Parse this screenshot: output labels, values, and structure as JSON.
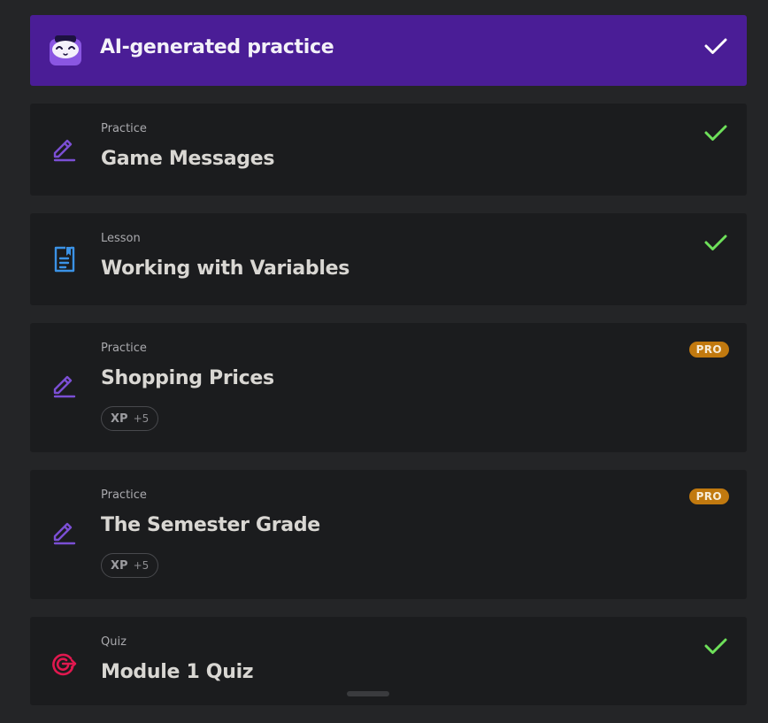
{
  "colors": {
    "background": "#242527",
    "card": "#1b1c1e",
    "ai_banner": "#4a1d96",
    "check_green": "#6ee05a",
    "pencil_purple": "#7b4fd4",
    "lesson_blue": "#3b92e6",
    "quiz_red": "#e0184f",
    "pro_badge": "#c1790f"
  },
  "ai_banner": {
    "title": "AI-generated practice",
    "icon": "ai-mascot-icon",
    "completed": true
  },
  "items": [
    {
      "type": "Practice",
      "title": "Game Messages",
      "icon": "pencil-icon",
      "completed": true
    },
    {
      "type": "Lesson",
      "title": "Working with Variables",
      "icon": "document-icon",
      "completed": true
    },
    {
      "type": "Practice",
      "title": "Shopping Prices",
      "icon": "pencil-icon",
      "badge": "PRO",
      "xp_label": "XP",
      "xp_value": "+5"
    },
    {
      "type": "Practice",
      "title": "The Semester Grade",
      "icon": "pencil-icon",
      "badge": "PRO",
      "xp_label": "XP",
      "xp_value": "+5"
    },
    {
      "type": "Quiz",
      "title": "Module 1 Quiz",
      "icon": "target-icon",
      "completed": true
    }
  ]
}
